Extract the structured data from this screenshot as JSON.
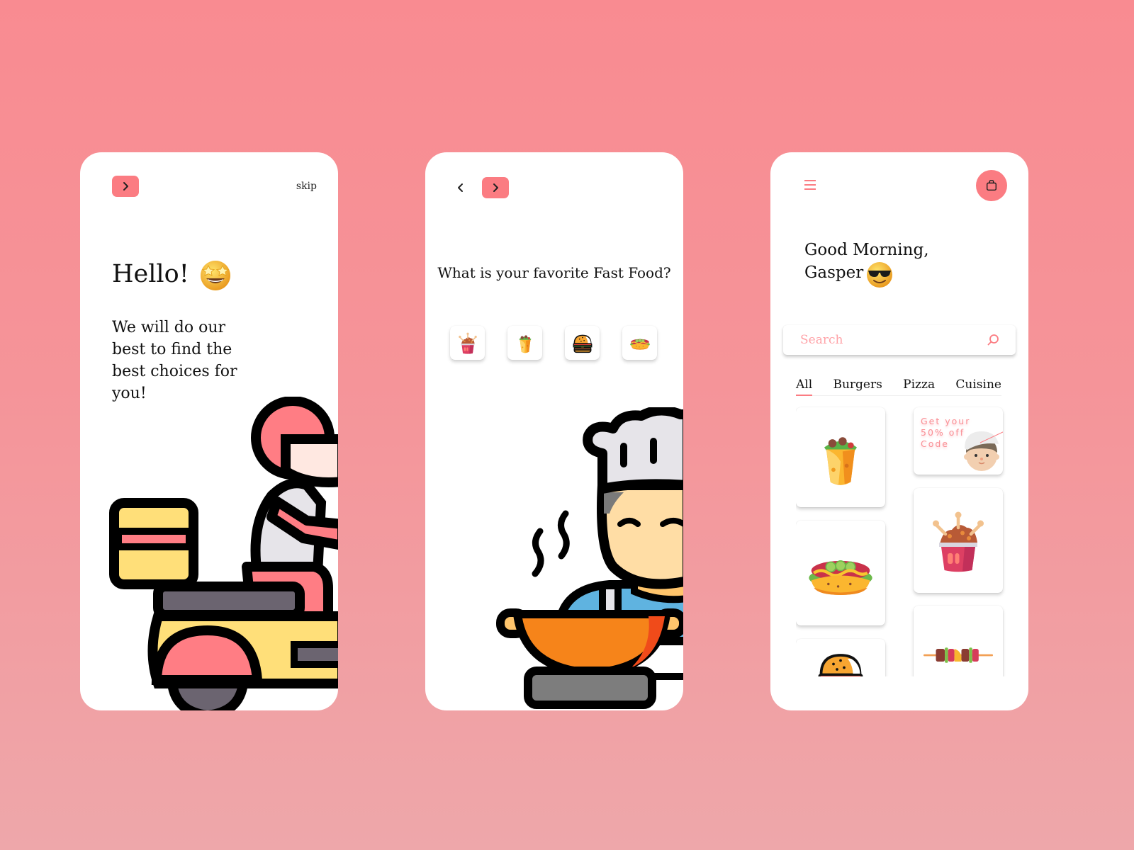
{
  "colors": {
    "accent": "#fb7c82",
    "background_top": "#f98b91",
    "background_bottom": "#eea7aa",
    "placeholder": "#ffa3a8"
  },
  "screen1": {
    "next_icon": "chevron-right-icon",
    "skip_label": "skip",
    "title": "Hello!",
    "title_emoji": "star-struck-emoji",
    "description": "We will do our best to find the best choices for you!",
    "illustration": "delivery-scooter-rider"
  },
  "screen2": {
    "back_icon": "chevron-left-icon",
    "next_icon": "chevron-right-icon",
    "question": "What is your favorite Fast Food?",
    "food_options": [
      {
        "name": "fried-chicken-bucket"
      },
      {
        "name": "burrito"
      },
      {
        "name": "burger"
      },
      {
        "name": "hot-dog"
      }
    ],
    "illustration": "chef-cooking-wok"
  },
  "screen3": {
    "menu_icon": "hamburger-menu-icon",
    "bag_icon": "shopping-bag-icon",
    "greeting_line1": "Good Morning,",
    "greeting_line2": "Gasper",
    "greeting_emoji": "sunglasses-emoji",
    "search": {
      "placeholder": "Search",
      "value": ""
    },
    "tabs": [
      {
        "label": "All",
        "active": true
      },
      {
        "label": "Burgers",
        "active": false
      },
      {
        "label": "Pizza",
        "active": false
      },
      {
        "label": "Cuisine",
        "active": false
      }
    ],
    "promo": {
      "line1": "Get your",
      "line2": "50% off",
      "line3": "Code"
    },
    "grid_items": [
      "burrito",
      "promo",
      "fried-chicken-bucket",
      "hot-dog",
      "kebab-skewer",
      "burger"
    ]
  }
}
